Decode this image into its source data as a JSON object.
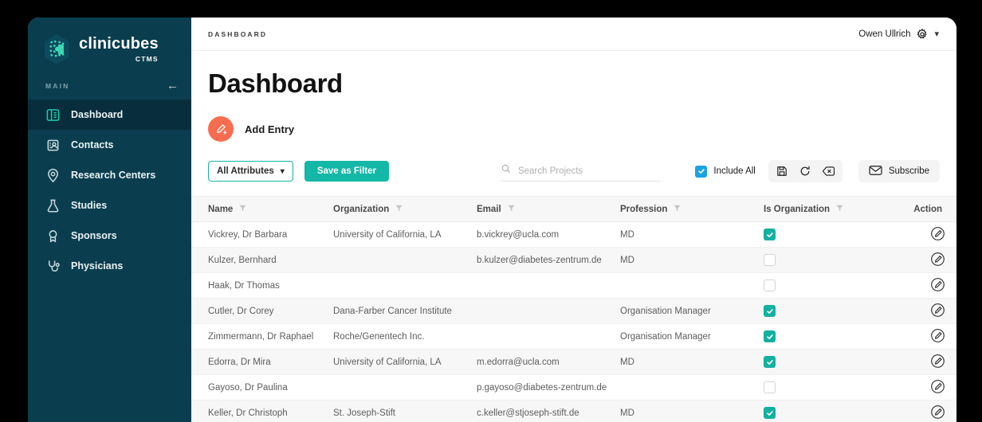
{
  "brand": {
    "name": "clinicubes",
    "sub": "CTMS",
    "logo_icon": "hexagon-dots-logo"
  },
  "sidebar": {
    "section_label": "MAIN",
    "collapse_icon": "arrow-left-icon",
    "items": [
      {
        "label": "Dashboard",
        "icon": "dashboard-icon",
        "active": true
      },
      {
        "label": "Contacts",
        "icon": "contact-card-icon",
        "active": false
      },
      {
        "label": "Research Centers",
        "icon": "map-pin-icon",
        "active": false
      },
      {
        "label": "Studies",
        "icon": "flask-icon",
        "active": false
      },
      {
        "label": "Sponsors",
        "icon": "award-ribbon-icon",
        "active": false
      },
      {
        "label": "Physicians",
        "icon": "stethoscope-icon",
        "active": false
      }
    ]
  },
  "header": {
    "breadcrumb": "DASHBOARD",
    "user_name": "Owen Ullrich",
    "gear_icon": "gear-icon",
    "caret_icon": "chevron-down-icon"
  },
  "page": {
    "title": "Dashboard"
  },
  "add_entry": {
    "label": "Add Entry",
    "icon": "pen-plus-icon",
    "color": "#f86d50"
  },
  "toolbar": {
    "attributes_select": {
      "value": "All Attributes",
      "caret_icon": "chevron-down-icon"
    },
    "save_filter_label": "Save as Filter",
    "search": {
      "placeholder": "Search Projects",
      "value": "",
      "icon": "search-icon"
    },
    "include_all": {
      "label": "Include All",
      "checked": true,
      "color": "#1aa3e0"
    },
    "icon_buttons": [
      {
        "name": "save-icon"
      },
      {
        "name": "refresh-icon"
      },
      {
        "name": "clear-filter-icon"
      }
    ],
    "subscribe": {
      "label": "Subscribe",
      "icon": "envelope-icon"
    }
  },
  "table": {
    "columns": [
      {
        "label": "Name",
        "filterable": true
      },
      {
        "label": "Organization",
        "filterable": true
      },
      {
        "label": "Email",
        "filterable": true
      },
      {
        "label": "Profession",
        "filterable": true
      },
      {
        "label": "Is Organization",
        "filterable": true
      },
      {
        "label": "Action",
        "filterable": false
      }
    ],
    "rows": [
      {
        "name": "Vickrey, Dr Barbara",
        "organization": "University of California, LA",
        "email": "b.vickrey@ucla.com",
        "profession": "MD",
        "is_organization": true,
        "action_icon": "edit-circle-icon"
      },
      {
        "name": "Kulzer, Bernhard",
        "organization": "",
        "email": "b.kulzer@diabetes-zentrum.de",
        "profession": "MD",
        "is_organization": false,
        "action_icon": "edit-circle-icon"
      },
      {
        "name": "Haak, Dr Thomas",
        "organization": "",
        "email": "",
        "profession": "",
        "is_organization": false,
        "action_icon": "edit-circle-icon"
      },
      {
        "name": "Cutler, Dr Corey",
        "organization": "Dana-Farber Cancer Institute",
        "email": "",
        "profession": "Organisation Manager",
        "is_organization": true,
        "action_icon": "edit-circle-icon"
      },
      {
        "name": "Zimmermann, Dr Raphael",
        "organization": "Roche/Genentech Inc.",
        "email": "",
        "profession": "Organisation Manager",
        "is_organization": true,
        "action_icon": "edit-circle-icon"
      },
      {
        "name": "Edorra, Dr Mira",
        "organization": "University of California, LA",
        "email": "m.edorra@ucla.com",
        "profession": "MD",
        "is_organization": true,
        "action_icon": "edit-circle-icon"
      },
      {
        "name": "Gayoso, Dr Paulina",
        "organization": "",
        "email": "p.gayoso@diabetes-zentrum.de",
        "profession": "",
        "is_organization": false,
        "action_icon": "edit-circle-icon"
      },
      {
        "name": "Keller, Dr Christoph",
        "organization": "St. Joseph-Stift",
        "email": "c.keller@stjoseph-stift.de",
        "profession": "MD",
        "is_organization": true,
        "action_icon": "edit-circle-icon"
      }
    ]
  },
  "colors": {
    "sidebar_bg": "#0a3e4f",
    "sidebar_active": "#082e3d",
    "accent_teal": "#14b8a6",
    "accent_orange": "#f86d50",
    "accent_blue": "#1aa3e0",
    "logo_mint": "#3ddbb4"
  }
}
